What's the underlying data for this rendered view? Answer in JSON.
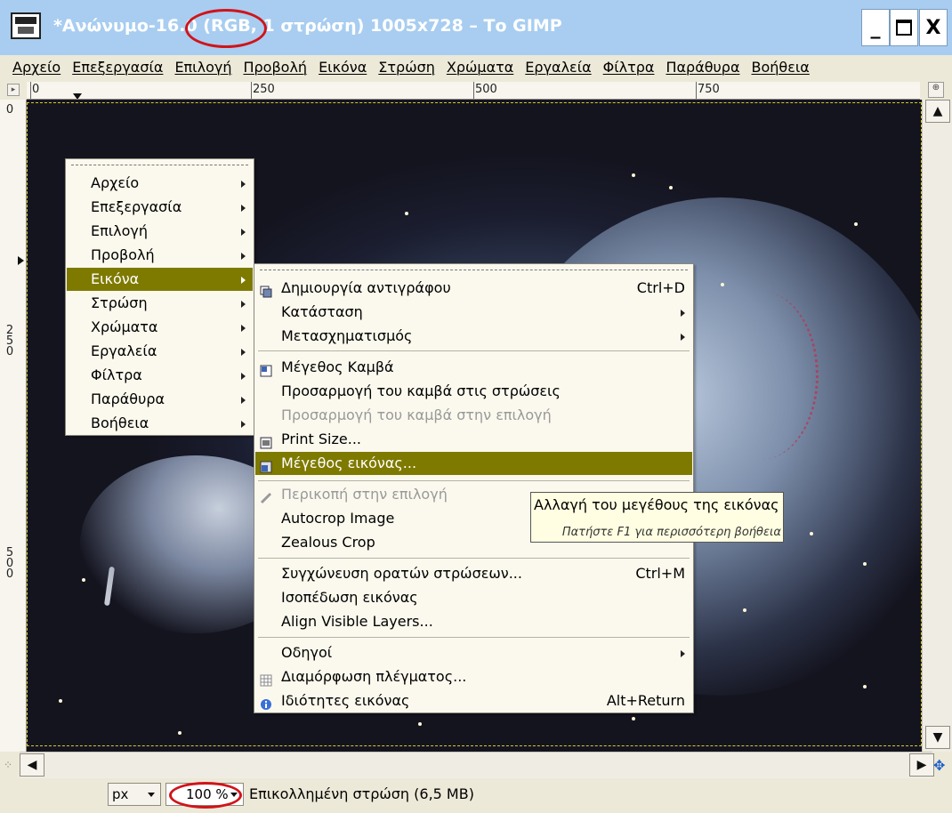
{
  "window": {
    "title": "*Ανώνυμο-16.0 (RGB, 1 στρώση) 1005x728 – Το GIMP",
    "buttons": [
      "_",
      "☐",
      "X"
    ]
  },
  "menubar": [
    "Αρχείο",
    "Επεξεργασία",
    "Επιλογή",
    "Προβολή",
    "Εικόνα",
    "Στρώση",
    "Χρώματα",
    "Εργαλεία",
    "Φίλτρα",
    "Παράθυρα",
    "Βοήθεια"
  ],
  "rulers": {
    "horizontal_labels": [
      "0",
      "250",
      "500",
      "750"
    ],
    "vertical_labels": [
      "0",
      "250",
      "500"
    ]
  },
  "context_menu": {
    "items": [
      "Αρχείο",
      "Επεξεργασία",
      "Επιλογή",
      "Προβολή",
      "Εικόνα",
      "Στρώση",
      "Χρώματα",
      "Εργαλεία",
      "Φίλτρα",
      "Παράθυρα",
      "Βοήθεια"
    ],
    "highlighted": "Εικόνα"
  },
  "image_submenu": {
    "items": [
      {
        "label": "Δημιουργία αντιγράφου",
        "shortcut": "Ctrl+D",
        "icon": "duplicate-icon"
      },
      {
        "label": "Κατάσταση",
        "submenu": true
      },
      {
        "label": "Μετασχηματισμός",
        "submenu": true
      },
      {
        "label": "Μέγεθος Καμβά",
        "icon": "canvas-size-icon"
      },
      {
        "label": "Προσαρμογή του καμβά στις στρώσεις"
      },
      {
        "label": "Προσαρμογή του καμβά στην επιλογή",
        "disabled": true
      },
      {
        "label": "Print Size...",
        "icon": "print-size-icon"
      },
      {
        "label": "Μέγεθος εικόνας...",
        "icon": "scale-image-icon",
        "highlighted": true
      },
      {
        "label": "Περικοπή στην επιλογή",
        "icon": "crop-icon",
        "disabled": true
      },
      {
        "label": "Autocrop Image"
      },
      {
        "label": "Zealous Crop"
      },
      {
        "label": "Συγχώνευση ορατών στρώσεων...",
        "shortcut": "Ctrl+M"
      },
      {
        "label": "Ισοπέδωση εικόνας"
      },
      {
        "label": "Align Visible Layers..."
      },
      {
        "label": "Οδηγοί",
        "submenu": true
      },
      {
        "label": "Διαμόρφωση πλέγματος...",
        "icon": "grid-icon"
      },
      {
        "label": "Ιδιότητες εικόνας",
        "shortcut": "Alt+Return",
        "icon": "info-icon"
      }
    ]
  },
  "tooltip": {
    "text": "Αλλαγή του μεγέθους της εικόνας",
    "help": "Πατήστε F1 για περισσότερη βοήθεια"
  },
  "statusbar": {
    "unit": "px",
    "zoom": "100 %",
    "message": "Επικολλημένη στρώση (6,5 MB)"
  },
  "colors": {
    "titlebar": "#a8cdf0",
    "highlight": "#7e7a00",
    "annotation_red": "#d0141a"
  }
}
